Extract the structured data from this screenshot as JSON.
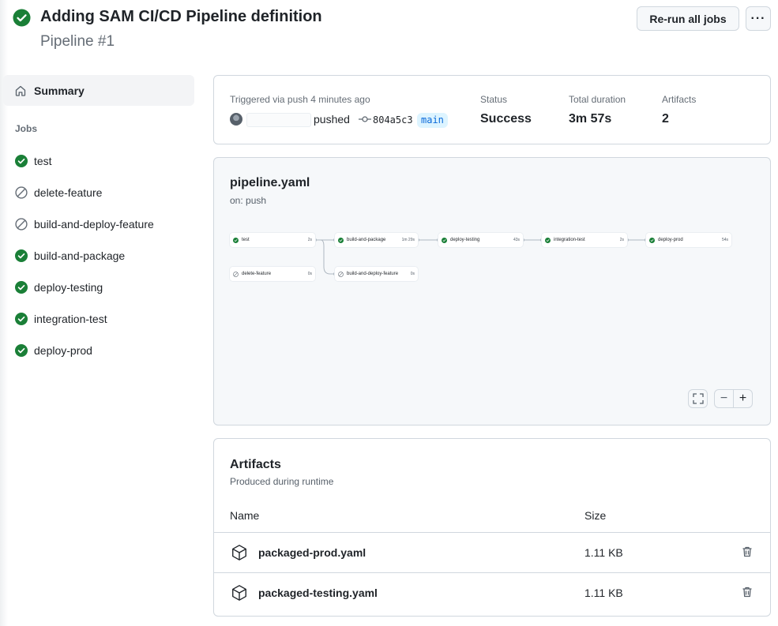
{
  "header": {
    "title": "Adding SAM CI/CD Pipeline definition",
    "subtitle": "Pipeline #1",
    "rerun_label": "Re-run all jobs",
    "more_label": "···"
  },
  "sidebar": {
    "summary_label": "Summary",
    "jobs_heading": "Jobs",
    "jobs": [
      {
        "label": "test",
        "status": "success"
      },
      {
        "label": "delete-feature",
        "status": "skipped"
      },
      {
        "label": "build-and-deploy-feature",
        "status": "skipped"
      },
      {
        "label": "build-and-package",
        "status": "success"
      },
      {
        "label": "deploy-testing",
        "status": "success"
      },
      {
        "label": "integration-test",
        "status": "success"
      },
      {
        "label": "deploy-prod",
        "status": "success"
      }
    ]
  },
  "summary": {
    "trigger_label": "Triggered via push 4 minutes ago",
    "pushed_label": "pushed",
    "commit": "804a5c3",
    "branch": "main",
    "status_label": "Status",
    "status_value": "Success",
    "duration_label": "Total duration",
    "duration_value": "3m 57s",
    "artifacts_label": "Artifacts",
    "artifacts_value": "2"
  },
  "graph": {
    "title": "pipeline.yaml",
    "subtitle": "on: push",
    "nodes": [
      {
        "name": "test",
        "duration": "2s",
        "status": "success"
      },
      {
        "name": "build-and-package",
        "duration": "1m 29s",
        "status": "success"
      },
      {
        "name": "deploy-testing",
        "duration": "43s",
        "status": "success"
      },
      {
        "name": "integration-test",
        "duration": "2s",
        "status": "success"
      },
      {
        "name": "deploy-prod",
        "duration": "54s",
        "status": "success"
      },
      {
        "name": "delete-feature",
        "duration": "0s",
        "status": "skipped"
      },
      {
        "name": "build-and-deploy-feature",
        "duration": "0s",
        "status": "skipped"
      }
    ],
    "zoom_minus": "−",
    "zoom_plus": "+"
  },
  "artifacts": {
    "title": "Artifacts",
    "subtitle": "Produced during runtime",
    "col_name": "Name",
    "col_size": "Size",
    "rows": [
      {
        "name": "packaged-prod.yaml",
        "size": "1.11 KB"
      },
      {
        "name": "packaged-testing.yaml",
        "size": "1.11 KB"
      }
    ]
  },
  "colors": {
    "success": "#1a7f37",
    "skipped": "#656d76",
    "accent": "#0969da"
  }
}
